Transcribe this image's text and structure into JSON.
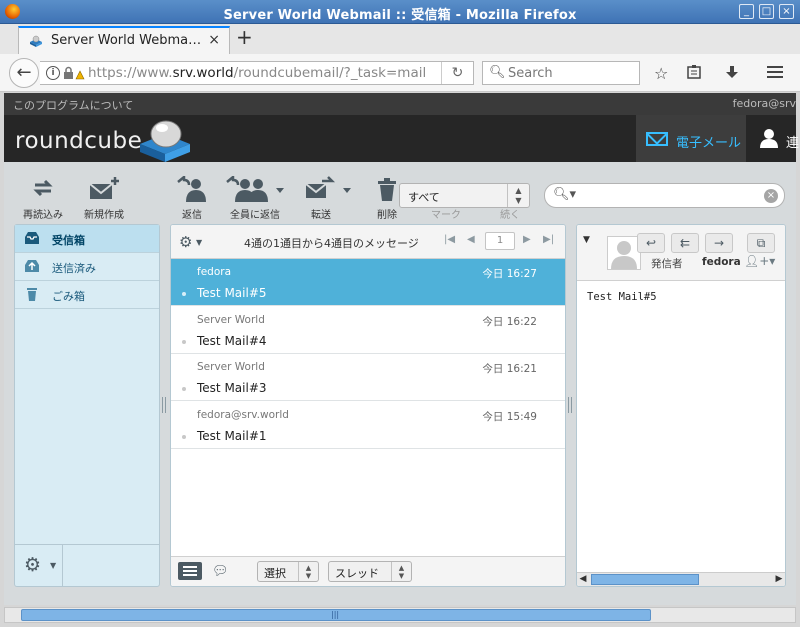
{
  "window": {
    "title": "Server World Webmail :: 受信箱 - Mozilla Firefox",
    "minimize_icon": "minimize-icon",
    "maximize_icon": "maximize-icon",
    "close_icon": "close-icon"
  },
  "browser": {
    "tab_title": "Server World Webma…",
    "tab_close": "×",
    "new_tab": "+",
    "url_prefix": "https://www.",
    "url_domain": "srv.world",
    "url_path": "/roundcubemail/?_task=mail",
    "search_placeholder": "Search"
  },
  "roundcube": {
    "about_link": "このプログラムについて",
    "user_name": "fedora@srv",
    "logo_text": "roundcube",
    "nav_mail": "電子メール",
    "nav_contacts": "連"
  },
  "toolbar": {
    "reload": "再読込み",
    "compose": "新規作成",
    "reply": "返信",
    "reply_all": "全員に返信",
    "forward": "転送",
    "delete": "削除",
    "mark": "マーク",
    "more": "続く",
    "filter_value": "すべて"
  },
  "folders": [
    {
      "label": "受信箱",
      "icon": "inbox-icon"
    },
    {
      "label": "送信済み",
      "icon": "sent-icon"
    },
    {
      "label": "ごみ箱",
      "icon": "trash-icon"
    }
  ],
  "message_list": {
    "count_text": "4通の1通目から4通目のメッセージ",
    "page": "1",
    "messages": [
      {
        "from": "fedora",
        "date": "今日 16:27",
        "subject": "Test Mail#5",
        "selected": true
      },
      {
        "from": "Server World",
        "date": "今日 16:22",
        "subject": "Test Mail#4",
        "selected": false
      },
      {
        "from": "Server World",
        "date": "今日 16:21",
        "subject": "Test Mail#3",
        "selected": false
      },
      {
        "from": "fedora@srv.world",
        "date": "今日 15:49",
        "subject": "Test Mail#1",
        "selected": false
      }
    ],
    "select_label": "選択",
    "thread_label": "スレッド"
  },
  "preview": {
    "sender_label": "発信者",
    "from_name": "fedora",
    "body": "Test Mail#5"
  },
  "colors": {
    "selected_row": "#4fb1d9",
    "accent": "#37beff",
    "header_bg": "#262626"
  }
}
